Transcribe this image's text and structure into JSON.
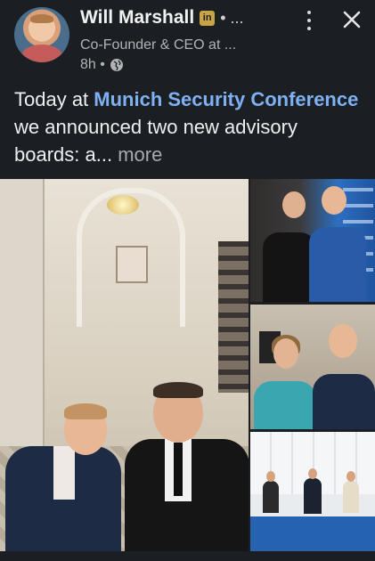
{
  "header": {
    "author_name": "Will Marshall",
    "linkedin_badge": "in",
    "name_suffix": "• ...",
    "subtitle": "Co-Founder & CEO at ...",
    "time": "8h •",
    "visibility_icon": "globe-icon",
    "menu_icon": "more-vertical-icon",
    "close_icon": "close-icon"
  },
  "post": {
    "text_before": "Today at ",
    "link_text": "Munich Security Conference",
    "text_after": " we announced two new advisory boards: a...",
    "more_label": " more"
  },
  "media": {
    "count": 4
  },
  "colors": {
    "background": "#1b1f23",
    "link": "#7fb1f2",
    "badge": "#c9a447"
  }
}
